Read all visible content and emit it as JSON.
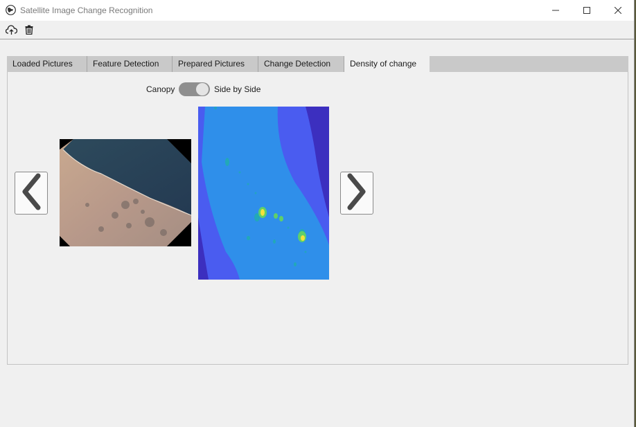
{
  "window": {
    "title": "Satellite Image Change Recognition"
  },
  "toolbar": {
    "upload_icon": "cloud-upload-icon",
    "delete_icon": "trash-icon"
  },
  "tabs": [
    {
      "label": "Loaded Pictures"
    },
    {
      "label": "Feature Detection"
    },
    {
      "label": "Prepared Pictures"
    },
    {
      "label": "Change Detection"
    },
    {
      "label": "Density of change"
    }
  ],
  "active_tab": "Density of change",
  "view_toggle": {
    "left_label": "Canopy",
    "right_label": "Side by Side",
    "state": "Side by Side"
  },
  "navigation": {
    "prev_icon": "chevron-left-icon",
    "next_icon": "chevron-right-icon"
  },
  "colors": {
    "accent_tab": "#f0f0f0",
    "tabstrip": "#c9c9c9",
    "density_low": "#4a5cf0",
    "density_mid": "#2f8fea",
    "density_high": "#f4e23a"
  }
}
